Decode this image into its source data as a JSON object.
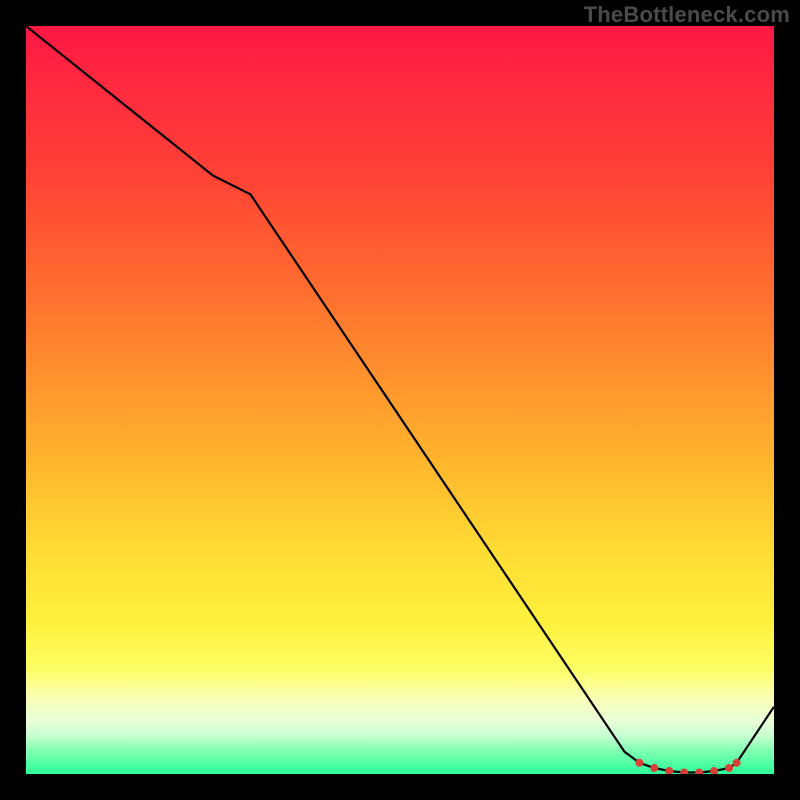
{
  "watermark": "TheBottleneck.com",
  "chart_data": {
    "type": "line",
    "title": "",
    "xlabel": "",
    "ylabel": "",
    "xlim": [
      0,
      100
    ],
    "ylim": [
      0,
      100
    ],
    "series": [
      {
        "name": "curve",
        "x": [
          0,
          25,
          30,
          80,
          82,
          84,
          86,
          88,
          90,
          92,
          94,
          95,
          100
        ],
        "values": [
          100,
          80,
          77.5,
          3,
          1.5,
          0.8,
          0.4,
          0.2,
          0.2,
          0.4,
          0.8,
          1.5,
          9
        ]
      }
    ],
    "markers": {
      "x": [
        82,
        84,
        86,
        88,
        90,
        92,
        94,
        95
      ],
      "values": [
        1.5,
        0.8,
        0.4,
        0.2,
        0.2,
        0.4,
        0.8,
        1.5
      ]
    },
    "gradient_stops": [
      {
        "pos": 0,
        "color": "#ff1744"
      },
      {
        "pos": 8,
        "color": "#ff2a3f"
      },
      {
        "pos": 20,
        "color": "#ff4236"
      },
      {
        "pos": 34,
        "color": "#ff6a2f"
      },
      {
        "pos": 46,
        "color": "#ff8f2e"
      },
      {
        "pos": 58,
        "color": "#ffb52e"
      },
      {
        "pos": 70,
        "color": "#ffdb33"
      },
      {
        "pos": 80,
        "color": "#fff23e"
      },
      {
        "pos": 86,
        "color": "#feff66"
      },
      {
        "pos": 90,
        "color": "#f9ffb8"
      },
      {
        "pos": 93,
        "color": "#e8ffd9"
      },
      {
        "pos": 95,
        "color": "#c3ffcf"
      },
      {
        "pos": 97,
        "color": "#7dffb0"
      },
      {
        "pos": 100,
        "color": "#2bff9a"
      }
    ]
  }
}
